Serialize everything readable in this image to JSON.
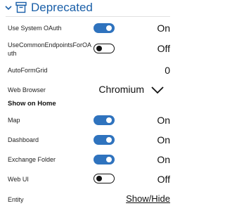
{
  "header": {
    "title": "Deprecated",
    "collapse_icon": "chevron-down-icon",
    "section_icon": "archive-icon",
    "accent_color": "#1a5fa8"
  },
  "rows": {
    "use_system_oauth": {
      "label": "Use System OAuth",
      "state": "On"
    },
    "use_common_endpoints": {
      "label_line1": "UseCommonEndpointsForOA",
      "label_line2": "uth",
      "state": "Off"
    },
    "auto_form_grid": {
      "label": "AutoFormGrid",
      "value": "0"
    },
    "web_browser": {
      "label": "Web Browser",
      "value": "Chromium"
    }
  },
  "show_on_home": {
    "heading": "Show on Home",
    "map": {
      "label": "Map",
      "state": "On"
    },
    "dashboard": {
      "label": "Dashboard",
      "state": "On"
    },
    "exchange_folder": {
      "label": "Exchange Folder",
      "state": "On"
    },
    "web_ui": {
      "label": "Web UI",
      "state": "Off"
    },
    "entity": {
      "label": "Entity",
      "link": "Show/Hide"
    }
  },
  "colors": {
    "toggle_on": "#2f73be",
    "toggle_off_border": "#111111"
  }
}
